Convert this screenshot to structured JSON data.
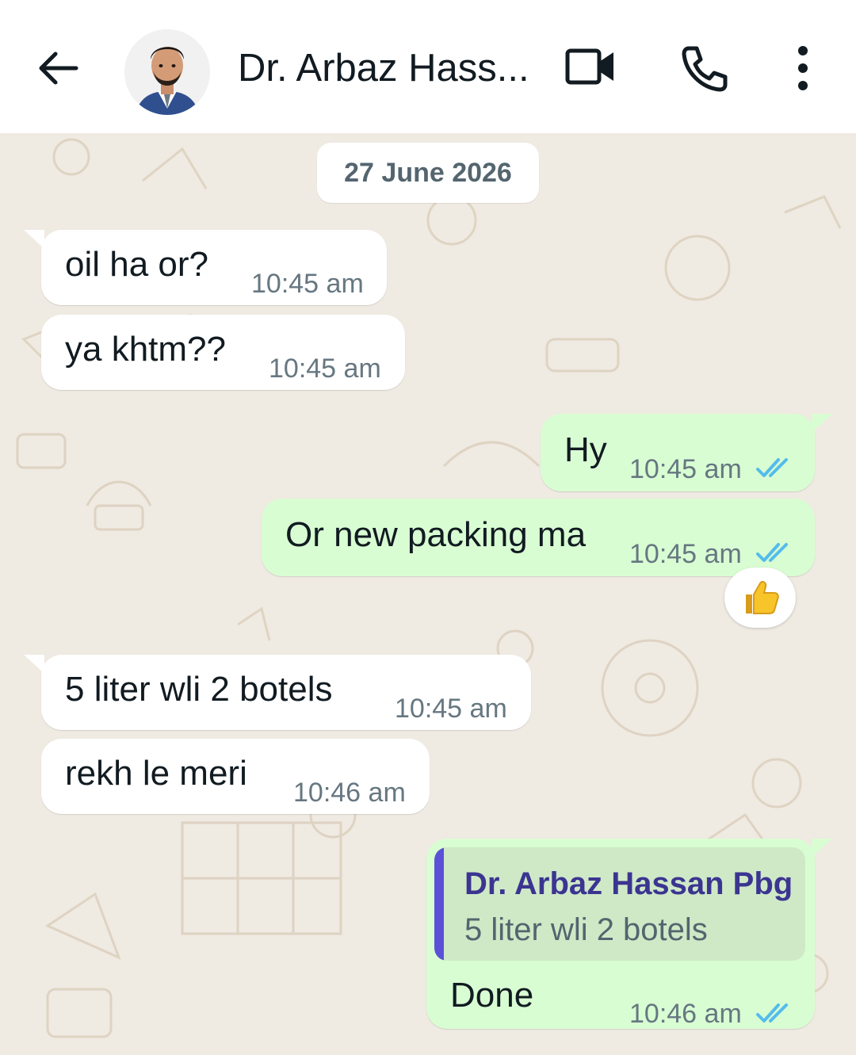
{
  "header": {
    "contact_name": "Dr. Arbaz Hass...",
    "back_icon": "arrow-left-icon",
    "video_icon": "video-call-icon",
    "phone_icon": "voice-call-icon",
    "menu_icon": "more-vertical-icon"
  },
  "chat": {
    "date_label": "27 June 2026",
    "messages": [
      {
        "direction": "in",
        "text": "oil ha or?",
        "time": "10:45 am"
      },
      {
        "direction": "in",
        "text": "ya khtm??",
        "time": "10:45 am"
      },
      {
        "direction": "out",
        "text": "Hy",
        "time": "10:45 am",
        "status": "read"
      },
      {
        "direction": "out",
        "text": "Or new packing ma",
        "time": "10:45 am",
        "status": "read",
        "reaction": "👍"
      },
      {
        "direction": "in",
        "text": "5 liter wli 2 botels",
        "time": "10:45 am"
      },
      {
        "direction": "in",
        "text": "rekh le meri",
        "time": "10:46 am"
      },
      {
        "direction": "out",
        "text": "Done",
        "time": "10:46 am",
        "status": "read",
        "quoted": {
          "author": "Dr. Arbaz Hassan Pbg",
          "text": "5 liter wli 2 botels"
        }
      }
    ]
  },
  "colors": {
    "incoming_bubble": "#ffffff",
    "outgoing_bubble": "#d9fdd3",
    "chat_background": "#efeae2",
    "read_ticks": "#53bdeb",
    "quote_bar": "#5b51d8"
  }
}
